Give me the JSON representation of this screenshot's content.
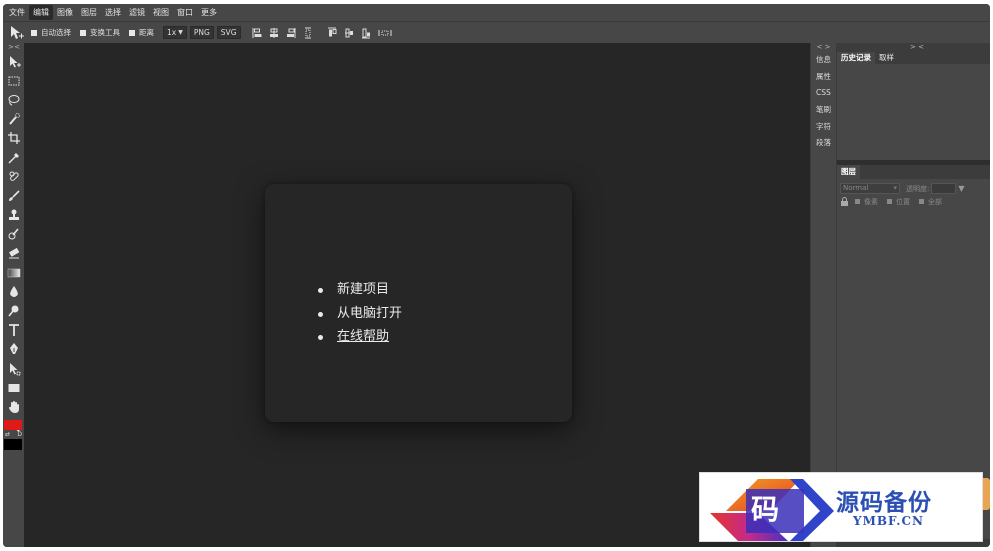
{
  "menu": [
    "文件",
    "编辑",
    "图像",
    "图层",
    "选择",
    "滤镜",
    "视图",
    "窗口",
    "更多"
  ],
  "menu_active_index": 1,
  "options": {
    "auto_select": "自动选择",
    "transform_tools": "变换工具",
    "distance": "距离",
    "scale": "1x",
    "png": "PNG",
    "svg": "SVG"
  },
  "toolbar": {
    "collapse": "> <",
    "tools": [
      "move-tool",
      "marquee-tool",
      "lasso-tool",
      "quick-select-tool",
      "crop-tool",
      "eyedropper-tool",
      "healing-tool",
      "brush-tool",
      "stamp-tool",
      "history-brush-tool",
      "eraser-tool",
      "gradient-tool",
      "blur-tool",
      "dodge-tool",
      "type-tool",
      "pen-tool",
      "path-select-tool",
      "shape-tool",
      "hand-tool",
      "zoom-tool"
    ],
    "color_fg": "#e01919",
    "color_bg": "#000000",
    "swap_label": "⇄",
    "default_label": "D"
  },
  "dialog": {
    "items": [
      "新建项目",
      "从电脑打开",
      "在线帮助"
    ]
  },
  "mini_panel": {
    "collapse": "< >",
    "tabs": [
      "信息",
      "属性",
      "CSS",
      "笔刷",
      "字符",
      "段落"
    ]
  },
  "right_panel": {
    "collapse": "> <",
    "tabs": [
      "历史记录",
      "取样"
    ],
    "layers_tab": "图层",
    "blend_mode": "Normal",
    "opacity_label": "透明度:",
    "lock_options": [
      "像素",
      "位置",
      "全部"
    ]
  },
  "watermark": {
    "char": "码",
    "title": "源码备份",
    "subtitle": "YMBF.CN"
  }
}
